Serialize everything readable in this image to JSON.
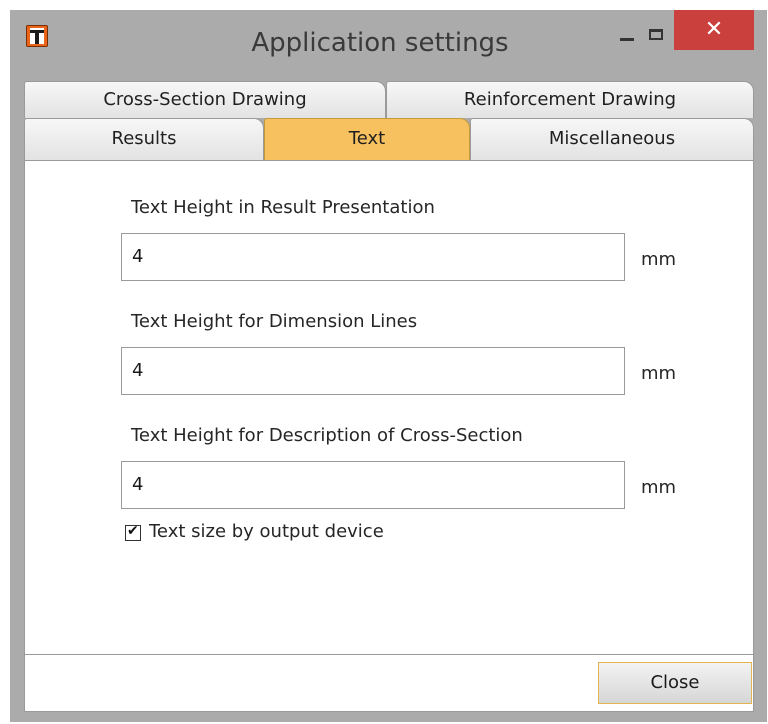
{
  "window": {
    "title": "Application settings"
  },
  "titlebar": {
    "icon": "app-t-icon",
    "minimize_icon": "minimize-icon",
    "maximize_icon": "maximize-icon",
    "close_glyph": "✕"
  },
  "tabs": {
    "row1": [
      "Cross-Section Drawing",
      "Reinforcement Drawing"
    ],
    "row2": [
      "Results",
      "Text",
      "Miscellaneous"
    ],
    "active": "Text",
    "active_color": "#f6c15e"
  },
  "fields": [
    {
      "label": "Text Height in Result Presentation",
      "value": "4",
      "unit": "mm"
    },
    {
      "label": "Text Height for Dimension Lines",
      "value": "4",
      "unit": "mm"
    },
    {
      "label": "Text Height for Description of Cross-Section",
      "value": "4",
      "unit": "mm"
    }
  ],
  "checkbox": {
    "label": "Text size by output device",
    "checked": true
  },
  "footer": {
    "close_label": "Close"
  },
  "colors": {
    "close_red": "#c9403c",
    "border_gray": "#ababab"
  }
}
